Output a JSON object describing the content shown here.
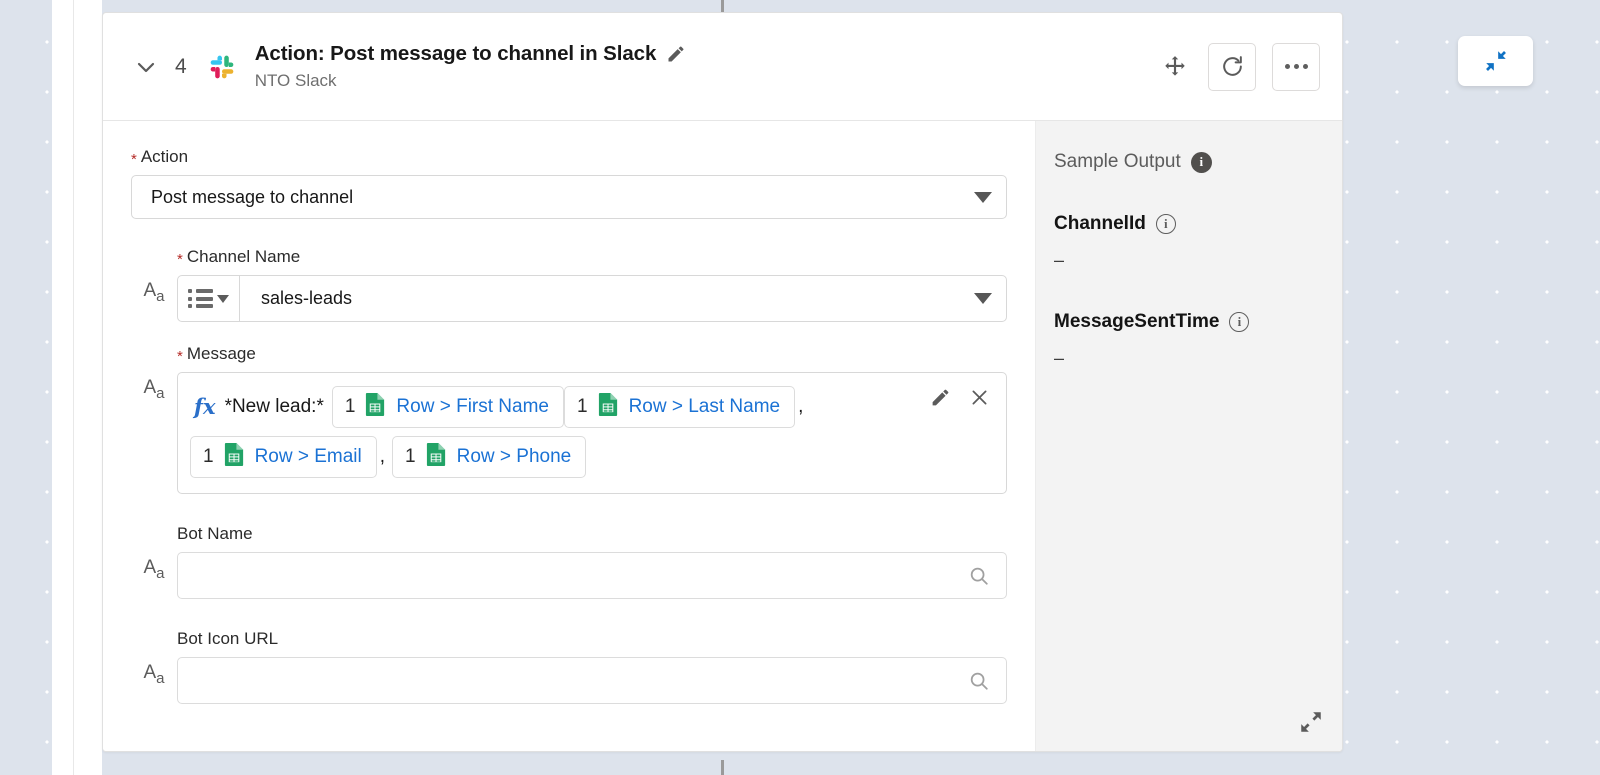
{
  "card": {
    "step_number": "4",
    "title": "Action: Post message to channel in Slack",
    "subtitle": "NTO Slack",
    "chevron_icon": "chevron-down-icon",
    "app_icon": "slack-icon",
    "edit_icon": "pencil-icon",
    "move_icon": "move-handle-icon",
    "refresh_icon": "refresh-icon",
    "overflow_icon": "more-options-icon"
  },
  "form": {
    "action": {
      "label": "Action",
      "required_marker": "*",
      "value": "Post message to channel",
      "caret_icon": "chevron-down-icon"
    },
    "channel_name": {
      "label": "Channel Name",
      "required_marker": "*",
      "value": "sales-leads",
      "type_icon": "text-type-icon",
      "picker_icon": "list-picker-icon",
      "caret_icon": "chevron-down-icon"
    },
    "message": {
      "label": "Message",
      "required_marker": "*",
      "type_icon": "text-type-icon",
      "formula_icon": "fx-icon",
      "formula_glyph": "fx",
      "static_text": "*New lead:*",
      "edit_icon": "pencil-icon",
      "clear_icon": "close-icon",
      "tokens": [
        {
          "ordinal": "1",
          "source_icon": "google-sheets-icon",
          "label": "Row > First Name",
          "separator": ""
        },
        {
          "ordinal": "1",
          "source_icon": "google-sheets-icon",
          "label": "Row > Last Name",
          "separator": ","
        },
        {
          "ordinal": "1",
          "source_icon": "google-sheets-icon",
          "label": "Row > Email",
          "separator": ","
        },
        {
          "ordinal": "1",
          "source_icon": "google-sheets-icon",
          "label": "Row > Phone",
          "separator": ""
        }
      ]
    },
    "bot_name": {
      "label": "Bot Name",
      "value": "",
      "placeholder": "",
      "type_icon": "text-type-icon",
      "search_icon": "search-icon"
    },
    "bot_icon_url": {
      "label": "Bot Icon URL",
      "value": "",
      "placeholder": "",
      "type_icon": "text-type-icon",
      "search_icon": "search-icon"
    }
  },
  "sample_output": {
    "title": "Sample Output",
    "title_info_icon": "info-icon",
    "resize_icon": "resize-expand-icon",
    "fields": [
      {
        "name": "ChannelId",
        "info_icon": "info-icon",
        "value": "–"
      },
      {
        "name": "MessageSentTime",
        "info_icon": "info-icon",
        "value": "–"
      }
    ]
  },
  "canvas": {
    "collapse_button_icon": "collapse-arrows-icon"
  },
  "colors": {
    "accent_blue": "#1b72d4",
    "required_red": "#b52b27",
    "sheets_green": "#21a366",
    "canvas_bg": "#dde3ec",
    "output_bg": "#f3f3f3"
  }
}
